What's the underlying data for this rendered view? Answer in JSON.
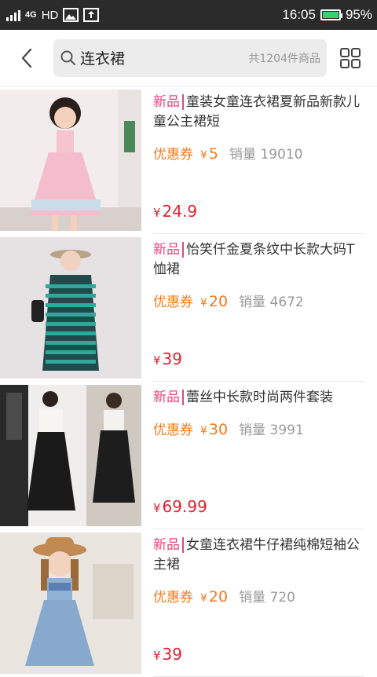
{
  "status_bar": {
    "network": "4G",
    "hd": "HD",
    "time": "16:05",
    "battery": "95%",
    "battery_level": 0.95
  },
  "search": {
    "query": "连衣裙",
    "result_count": "共1204件商品"
  },
  "colors": {
    "tag": "#e8457a",
    "promo": "#f07a1c",
    "price": "#e0202e"
  },
  "products": [
    {
      "tag": "新品",
      "title": "童装女童连衣裙夏新品新款儿童公主裙短",
      "coupon_label": "优惠券",
      "coupon_currency": "¥",
      "coupon_value": "5",
      "sales": "销量 19010",
      "price_currency": "¥",
      "price": "24.9"
    },
    {
      "tag": "新品",
      "title": "怡笑仟金夏条纹中长款大码T恤裙",
      "coupon_label": "优惠券",
      "coupon_currency": "¥",
      "coupon_value": "20",
      "sales": "销量 4672",
      "price_currency": "¥",
      "price": "39"
    },
    {
      "tag": "新品",
      "title": "蕾丝中长款时尚两件套装",
      "coupon_label": "优惠券",
      "coupon_currency": "¥",
      "coupon_value": "30",
      "sales": "销量 3991",
      "price_currency": "¥",
      "price": "69.99"
    },
    {
      "tag": "新品",
      "title": "女童连衣裙牛仔裙纯棉短袖公主裙",
      "coupon_label": "优惠券",
      "coupon_currency": "¥",
      "coupon_value": "20",
      "sales": "销量 720",
      "price_currency": "¥",
      "price": "39"
    }
  ]
}
